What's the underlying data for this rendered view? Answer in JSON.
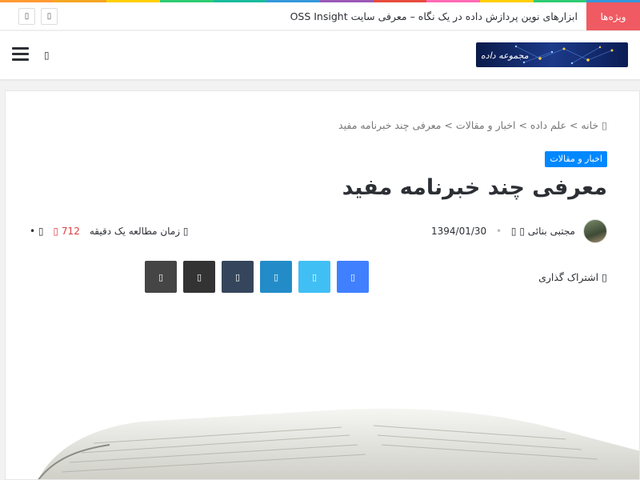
{
  "stripe_colors": [
    "#ff9933",
    "#f5a623",
    "#ffd000",
    "#2ecc71",
    "#1abc9c",
    "#3498db",
    "#9b59b6",
    "#e74c3c",
    "#ff69b4",
    "#ffd000",
    "#2ecc71",
    "#3498db"
  ],
  "topbar": {
    "trend_label": "ویژه‌ها",
    "ticker_text": "ابزارهای نوین پردازش داده در یک نگاه – معرفی سایت OSS Insight",
    "next_icon": "chevron-right-icon",
    "prev_icon": "chevron-left-icon",
    "nav_glyph": "▯"
  },
  "header": {
    "logo_text": "مجموعه داده",
    "menu_icon": "hamburger-menu-icon",
    "search_icon": "search-icon",
    "search_glyph": "▯"
  },
  "breadcrumb": {
    "home_icon": "▯",
    "home": "خانه",
    "sep": ">",
    "cat1": "علم داده",
    "cat2": "اخبار و مقالات",
    "current": "معرفی چند خبرنامه مفید"
  },
  "post": {
    "category": "اخبار و مقالات",
    "title": "معرفی چند خبرنامه مفید",
    "author": "مجتبی بنائی",
    "author_icon": "▯",
    "date": "1394/01/30",
    "date_icon": "▯",
    "comments": "▯ •",
    "views": "712 ▯",
    "read_time": "▯ زمان مطالعه یک دقیقه"
  },
  "share": {
    "label": "▯ اشتراک گذاری",
    "buttons": [
      {
        "name": "facebook",
        "color": "#4080ff",
        "glyph": "▯"
      },
      {
        "name": "twitter",
        "color": "#40bff5",
        "glyph": "▯"
      },
      {
        "name": "linkedin",
        "color": "#238cc8",
        "glyph": "▯"
      },
      {
        "name": "tumblr",
        "color": "#35465c",
        "glyph": "▯"
      },
      {
        "name": "print",
        "color": "#333333",
        "glyph": "▯"
      },
      {
        "name": "email",
        "color": "#454545",
        "glyph": "▯"
      }
    ]
  },
  "image": {
    "icon": "newspaper-image"
  }
}
